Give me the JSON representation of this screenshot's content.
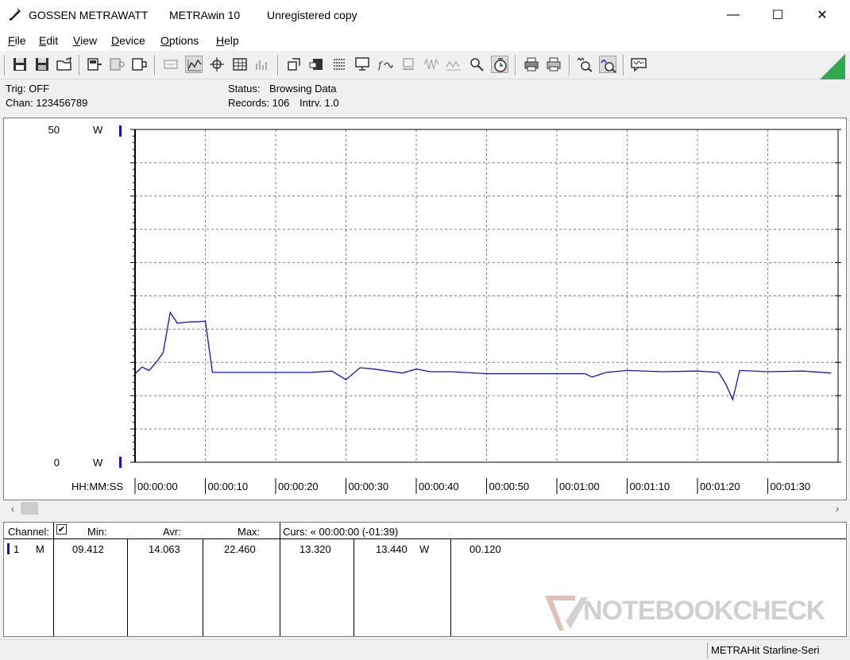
{
  "titlebar": {
    "company": "GOSSEN METRAWATT",
    "product": "METRAwin 10",
    "license": "Unregistered copy",
    "controls": [
      "—",
      "☐",
      "✕"
    ]
  },
  "menu": [
    "File",
    "Edit",
    "View",
    "Device",
    "Options",
    "Help"
  ],
  "info": {
    "trig": "Trig: OFF",
    "chan": "Chan:  123456789",
    "status_label": "Status:",
    "status_value": "Browsing Data",
    "records_label": "Records: 106",
    "interval_label": "Intrv. 1.0"
  },
  "colors": {
    "trace": "#1010e0",
    "grid": "#808080",
    "accent_green": "#2fa84f"
  },
  "chart_data": {
    "type": "line",
    "ylabel_unit": "W",
    "ylim": [
      0,
      50
    ],
    "y_tick_labels": [
      "50",
      "0"
    ],
    "x_axis_label": "HH:MM:SS",
    "x_tick_labels": [
      "00:00:00",
      "00:00:10",
      "00:00:20",
      "00:00:30",
      "00:00:40",
      "00:00:50",
      "00:01:00",
      "00:01:10",
      "00:01:20",
      "00:01:30"
    ],
    "xlim": [
      0,
      99
    ],
    "grid": true,
    "series": [
      {
        "x": [
          0,
          1,
          2,
          3,
          4,
          5,
          6,
          7,
          8,
          9,
          10,
          11,
          12,
          15,
          20,
          25,
          28,
          30,
          32,
          34,
          38,
          40,
          42,
          45,
          50,
          55,
          60,
          64,
          65,
          67,
          70,
          75,
          80,
          83,
          84,
          85,
          86,
          90,
          95,
          99
        ],
        "y": [
          13.3,
          14.3,
          13.8,
          15.0,
          16.5,
          22.5,
          20.9,
          21.0,
          21.1,
          21.1,
          21.2,
          13.5,
          13.5,
          13.5,
          13.5,
          13.5,
          13.7,
          12.4,
          14.2,
          14.0,
          13.4,
          14.0,
          13.6,
          13.6,
          13.3,
          13.3,
          13.3,
          13.3,
          12.8,
          13.5,
          13.8,
          13.6,
          13.7,
          13.5,
          11.8,
          9.4,
          13.8,
          13.6,
          13.7,
          13.4
        ]
      }
    ]
  },
  "table": {
    "headers": {
      "channel": "Channel:",
      "check": "✔",
      "min": "Min:",
      "avr": "Avr:",
      "max": "Max:",
      "curs": "Curs: « 00:00:00 (-01:39)"
    },
    "row": {
      "channel_no": "1",
      "mode": "M",
      "min": "09.412",
      "avr": "14.063",
      "max": "22.460",
      "curs1": "13.320",
      "curs2": "13.440",
      "unit": "W",
      "delta": "00.120"
    }
  },
  "statusbar": {
    "device": "METRAHit Starline-Seri"
  },
  "watermark": {
    "text": "NOTEBOOKCHECK"
  }
}
